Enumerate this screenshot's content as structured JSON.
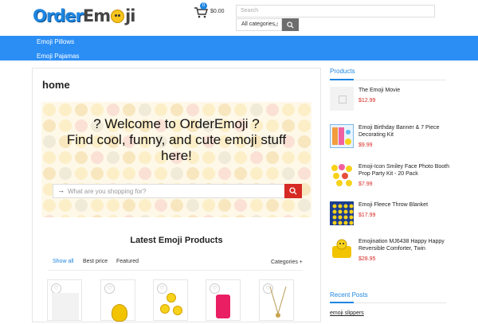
{
  "header": {
    "logo_first": "Order",
    "logo_second_a": "Em",
    "logo_second_b": "ji",
    "cart_count": "0",
    "cart_total": "$0.00",
    "search_placeholder": "Search",
    "category_select": "All categories"
  },
  "nav": {
    "items": [
      {
        "label": "Emoji Pillows"
      },
      {
        "label": "Emoji Pajamas"
      }
    ]
  },
  "main": {
    "page_title": "home",
    "hero_line1": "? Welcome to OrderEmoji ?",
    "hero_line2": "Find cool, funny, and cute emoji stuff",
    "hero_line3": "here!",
    "hero_search_placeholder": "What are you shopping for?",
    "latest_title": "Latest Emoji Products",
    "filters": [
      {
        "label": "Show all"
      },
      {
        "label": "Best price"
      },
      {
        "label": "Featured"
      }
    ],
    "categories_dropdown": "Categories +"
  },
  "sidebar": {
    "products_title": "Products",
    "products": [
      {
        "name": "The Emoji Movie",
        "price": "$12.99"
      },
      {
        "name": "Emoji Birthday Banner & 7 Piece Decorating Kit",
        "price": "$9.99"
      },
      {
        "name": "Emoji-Icon Smiley Face Photo Booth Prop Party Kit - 20 Pack",
        "price": "$7.99"
      },
      {
        "name": "Emoji Fleece Throw Blanket",
        "price": "$17.99"
      },
      {
        "name": "Emojination MJ6438 Happy Happy Reversible Comforter, Twin",
        "price": "$28.95"
      }
    ],
    "recent_title": "Recent Posts",
    "recent_posts": [
      {
        "title": "emoji slippers"
      }
    ]
  },
  "colors": {
    "brand_blue": "#2b8ef5",
    "price_red": "#d62a24",
    "search_red": "#d62a24"
  }
}
